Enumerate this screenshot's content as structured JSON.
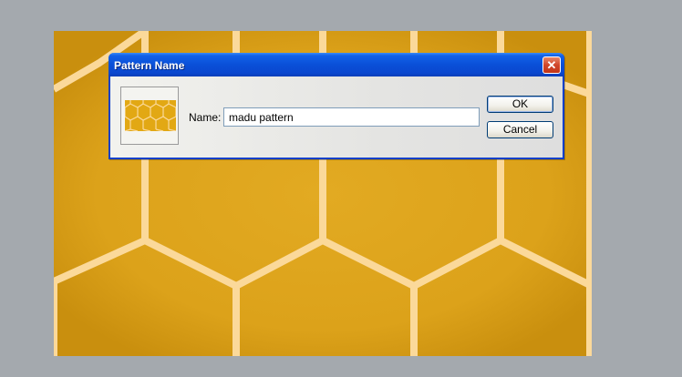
{
  "dialog": {
    "title": "Pattern Name",
    "close_glyph": "✕",
    "name_label": "Name:",
    "name_value": "madu pattern",
    "ok_label": "OK",
    "cancel_label": "Cancel"
  },
  "icons": {
    "close": "close-icon",
    "pattern_preview": "honeycomb-pattern-thumbnail"
  },
  "colors": {
    "honey": "#e2a814",
    "wax_border": "#fbd99a",
    "titlebar": "#0a50d8",
    "background": "#a4a9ae"
  }
}
